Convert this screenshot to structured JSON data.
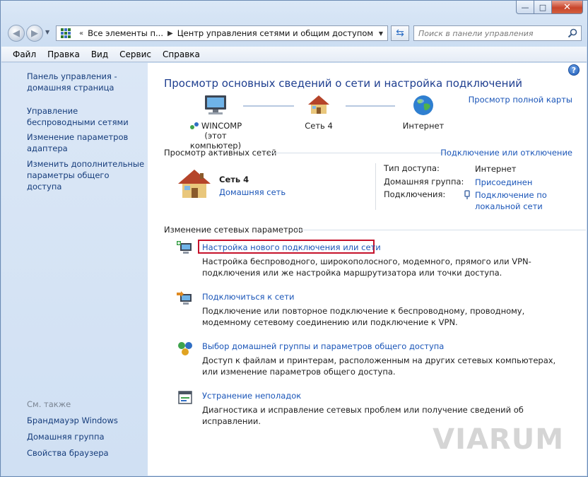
{
  "window": {
    "caption_min": "—",
    "caption_max": "□",
    "caption_close": "✕"
  },
  "nav": {
    "breadcrumb": [
      "Все элементы п...",
      "Центр управления сетями и общим доступом"
    ],
    "search_placeholder": "Поиск в панели управления"
  },
  "menu": [
    {
      "label": "Файл"
    },
    {
      "label": "Правка"
    },
    {
      "label": "Вид"
    },
    {
      "label": "Сервис"
    },
    {
      "label": "Справка"
    }
  ],
  "sidebar": {
    "links": [
      "Панель управления - домашняя страница",
      "Управление беспроводными сетями",
      "Изменение параметров адаптера",
      "Изменить дополнительные параметры общего доступа"
    ],
    "see_also_title": "См. также",
    "see_also": [
      "Брандмауэр Windows",
      "Домашняя группа",
      "Свойства браузера"
    ]
  },
  "main": {
    "help": "?",
    "title": "Просмотр основных сведений о сети и настройка подключений",
    "full_map": "Просмотр полной карты",
    "map": {
      "computer_name": "WINCOMP",
      "computer_sub": "(этот компьютер)",
      "network": "Сеть  4",
      "internet": "Интернет"
    },
    "active_networks": {
      "heading": "Просмотр активных сетей",
      "connect_link": "Подключение или отключение",
      "network_name": "Сеть  4",
      "network_type": "Домашняя сеть",
      "access_type_label": "Тип доступа:",
      "access_type_value": "Интернет",
      "homegroup_label": "Домашняя группа:",
      "homegroup_value": "Присоединен",
      "connections_label": "Подключения:",
      "connections_value": "Подключение по локальной сети"
    },
    "change_settings": {
      "heading": "Изменение сетевых параметров",
      "tasks": [
        {
          "link": "Настройка нового подключения или сети",
          "desc": "Настройка беспроводного, широкополосного, модемного, прямого или VPN-подключения или же настройка маршрутизатора или точки доступа."
        },
        {
          "link": "Подключиться к сети",
          "desc": "Подключение или повторное подключение к беспроводному, проводному, модемному сетевому соединению или подключение к VPN."
        },
        {
          "link": "Выбор домашней группы и параметров общего доступа",
          "desc": "Доступ к файлам и принтерам, расположенным на других сетевых компьютерах, или изменение параметров общего доступа."
        },
        {
          "link": "Устранение неполадок",
          "desc": "Диагностика и исправление сетевых проблем или получение сведений об исправлении."
        }
      ]
    }
  },
  "watermark": "VIARUM",
  "colors": {
    "link": "#1a55b8",
    "title": "#1e3e8f",
    "highlight": "#c6122b"
  }
}
